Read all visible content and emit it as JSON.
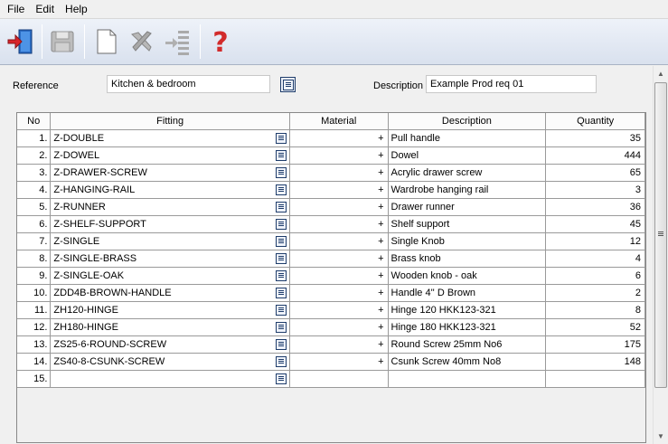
{
  "menu": {
    "file": "File",
    "edit": "Edit",
    "help": "Help"
  },
  "toolbar": {
    "buttons": [
      "exit-icon",
      "save-icon",
      "new-document-icon",
      "delete-icon",
      "insert-row-icon",
      "help-icon"
    ]
  },
  "form": {
    "reference_label": "Reference",
    "reference_value": "Kitchen & bedroom",
    "description_label": "Description",
    "description_value": "Example Prod req 01"
  },
  "grid": {
    "headers": {
      "no": "No",
      "fitting": "Fitting",
      "material": "Material",
      "description": "Description",
      "quantity": "Quantity"
    },
    "rows": [
      {
        "no": "1.",
        "fitting": "Z-DOUBLE",
        "material": "+",
        "description": "Pull handle",
        "quantity": "35"
      },
      {
        "no": "2.",
        "fitting": "Z-DOWEL",
        "material": "+",
        "description": "Dowel",
        "quantity": "444"
      },
      {
        "no": "3.",
        "fitting": "Z-DRAWER-SCREW",
        "material": "+",
        "description": "Acrylic drawer screw",
        "quantity": "65"
      },
      {
        "no": "4.",
        "fitting": "Z-HANGING-RAIL",
        "material": "+",
        "description": "Wardrobe hanging rail",
        "quantity": "3"
      },
      {
        "no": "5.",
        "fitting": "Z-RUNNER",
        "material": "+",
        "description": "Drawer runner",
        "quantity": "36"
      },
      {
        "no": "6.",
        "fitting": "Z-SHELF-SUPPORT",
        "material": "+",
        "description": "Shelf support",
        "quantity": "45"
      },
      {
        "no": "7.",
        "fitting": "Z-SINGLE",
        "material": "+",
        "description": "Single Knob",
        "quantity": "12"
      },
      {
        "no": "8.",
        "fitting": "Z-SINGLE-BRASS",
        "material": "+",
        "description": "Brass knob",
        "quantity": "4"
      },
      {
        "no": "9.",
        "fitting": "Z-SINGLE-OAK",
        "material": "+",
        "description": "Wooden knob - oak",
        "quantity": "6"
      },
      {
        "no": "10.",
        "fitting": "ZDD4B-BROWN-HANDLE",
        "material": "+",
        "description": "Handle 4'' D Brown",
        "quantity": "2"
      },
      {
        "no": "11.",
        "fitting": "ZH120-HINGE",
        "material": "+",
        "description": "Hinge 120 HKK123-321",
        "quantity": "8"
      },
      {
        "no": "12.",
        "fitting": "ZH180-HINGE",
        "material": "+",
        "description": "Hinge 180 HKK123-321",
        "quantity": "52"
      },
      {
        "no": "13.",
        "fitting": "ZS25-6-ROUND-SCREW",
        "material": "+",
        "description": "Round Screw 25mm No6",
        "quantity": "175"
      },
      {
        "no": "14.",
        "fitting": "ZS40-8-CSUNK-SCREW",
        "material": "+",
        "description": "Csunk Screw 40mm No8",
        "quantity": "148"
      },
      {
        "no": "15.",
        "fitting": "",
        "material": "",
        "description": "",
        "quantity": ""
      }
    ]
  }
}
